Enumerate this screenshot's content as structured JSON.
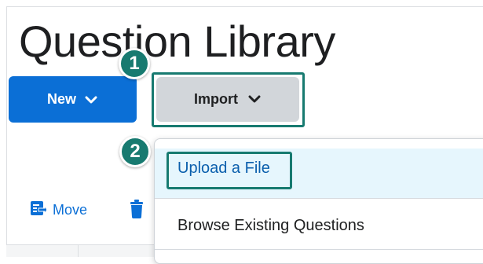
{
  "page": {
    "title": "Question Library"
  },
  "actions": {
    "new_label": "New",
    "import_label": "Import"
  },
  "callouts": {
    "step1": "1",
    "step2": "2"
  },
  "toolbar": {
    "move_label": "Move"
  },
  "import_menu": {
    "items": [
      {
        "label": "Upload a File",
        "highlighted": true
      },
      {
        "label": "Browse Existing Questions",
        "highlighted": false
      }
    ]
  },
  "colors": {
    "primary_button": "#0b6fd6",
    "callout_teal": "#177a70",
    "import_button": "#d2d6da",
    "menu_highlight": "#e6f6fd",
    "link_text": "#0b5fad"
  },
  "icons": {
    "new_chevron": "chevron-down-icon",
    "import_chevron": "chevron-down-icon",
    "move": "move-icon",
    "delete": "trash-icon"
  }
}
